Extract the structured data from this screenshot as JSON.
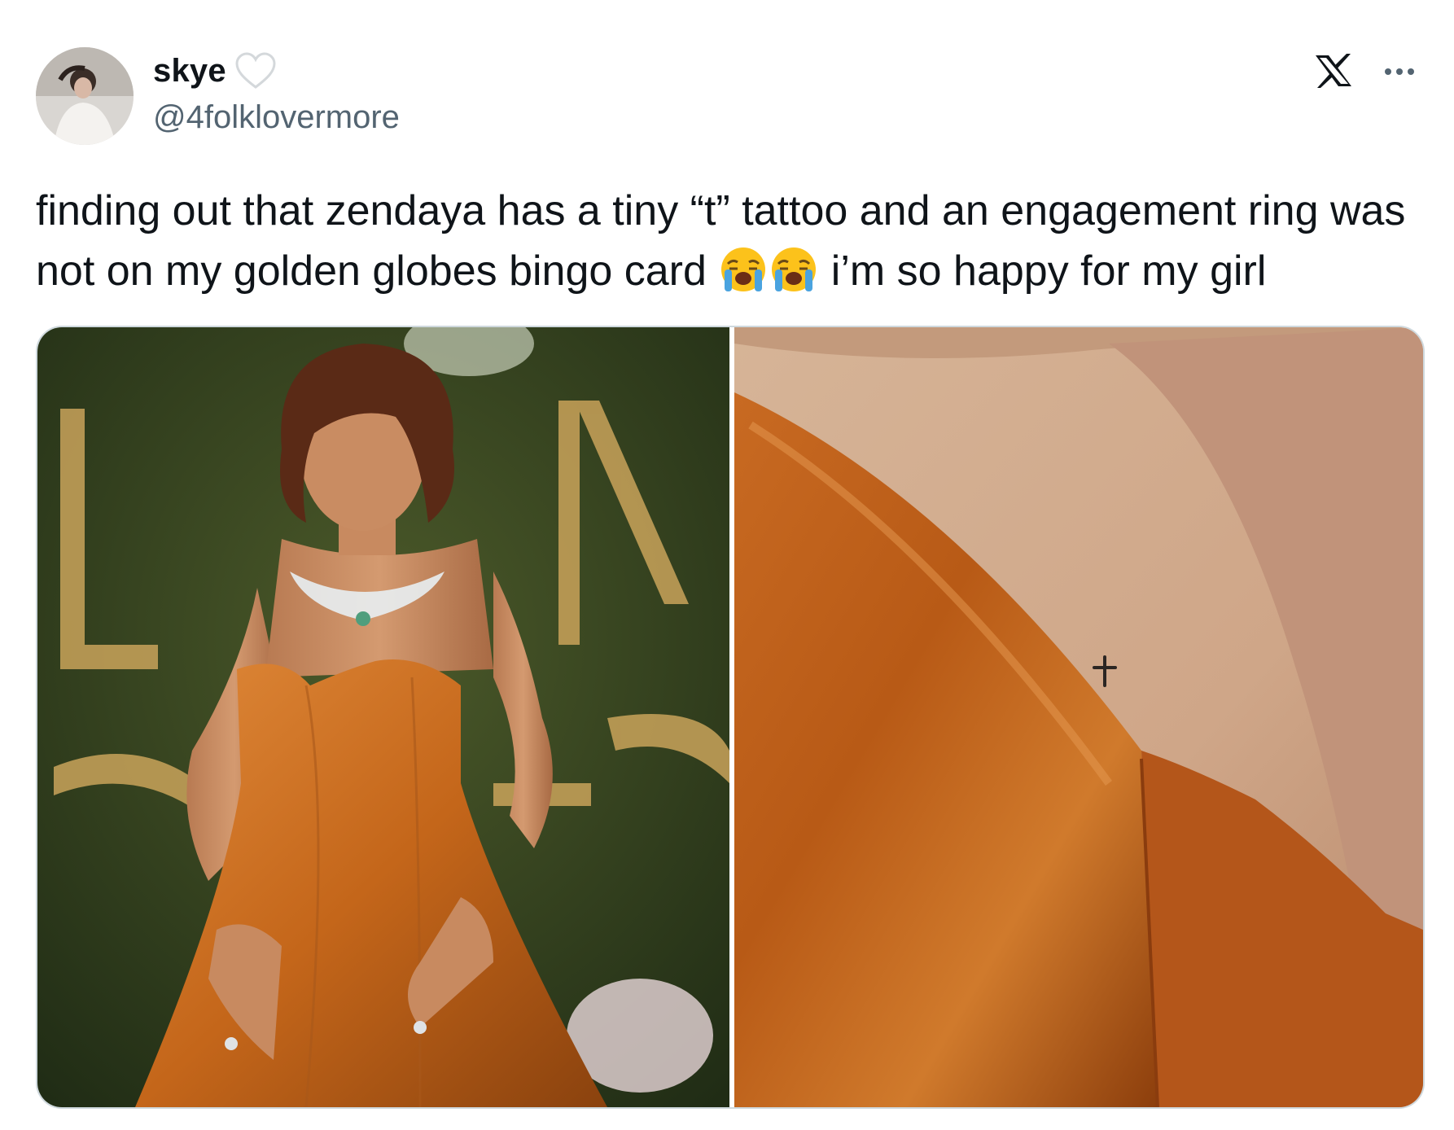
{
  "author": {
    "display_name": "skye",
    "handle": "@4folklovermore",
    "avatar_icon": "profile-photo",
    "badge_icon": "white-heart-icon"
  },
  "header_actions": {
    "platform_icon": "x-logo-icon",
    "more_icon": "more-dots-icon"
  },
  "tweet": {
    "text_part1": "finding out that zendaya has a tiny “t” tattoo and an engagement ring was not on my golden globes bingo card ",
    "emoji": "😭😭",
    "text_part2": " i’m so happy for my girl"
  },
  "media": {
    "count": 2,
    "photos": [
      {
        "subject": "woman in strapless orange satin gown at golden globes"
      },
      {
        "subject": "close-up of tiny t tattoo above orange satin neckline"
      }
    ]
  },
  "colors": {
    "text_primary": "#0f1419",
    "text_secondary": "#536471",
    "border": "#cfd9de",
    "dress_orange": "#c4661a"
  }
}
